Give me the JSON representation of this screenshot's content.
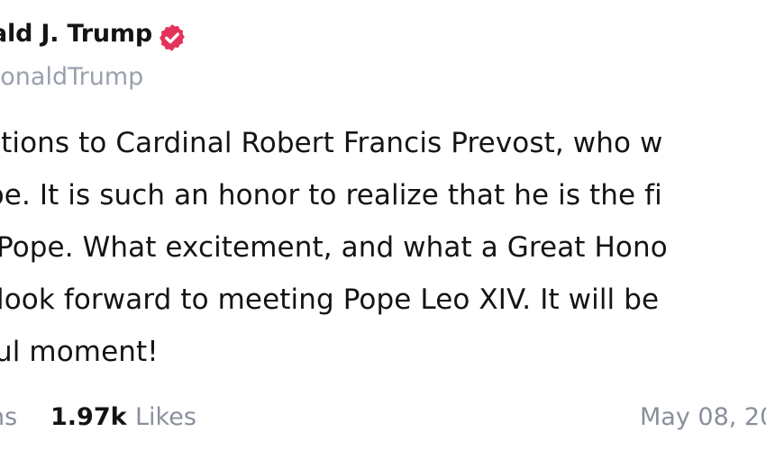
{
  "post": {
    "author_name": "ald J. Trump",
    "handle": "lDonaldTrump",
    "body_lines": [
      "ations to Cardinal Robert Francis Prevost, who w",
      "pe. It is such an honor to realize that he is the fi",
      " Pope. What excitement, and what a Great Hono",
      " look forward to meeting Pope Leo XIV. It will be",
      "ul moment!"
    ],
    "reposts_label": "ns",
    "likes_count": "1.97k",
    "likes_label": "Likes",
    "date": "May 08, 20"
  },
  "colors": {
    "verified_badge": "#e4335b",
    "text_primary": "#141414",
    "text_muted": "#8a8f9c"
  },
  "icons": {
    "verified": "verified-badge-icon"
  }
}
